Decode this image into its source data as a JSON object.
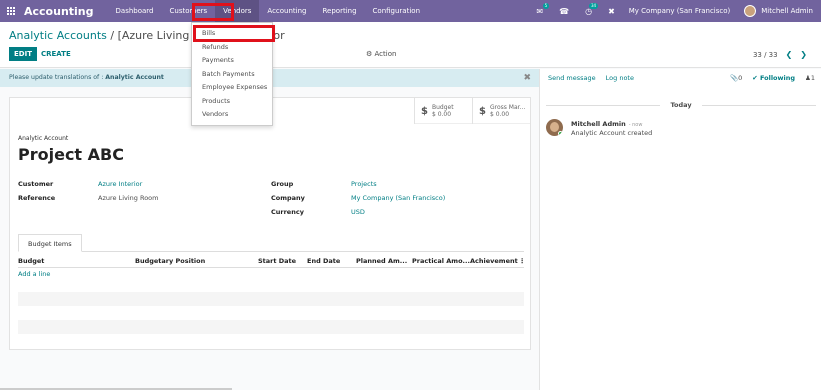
{
  "navbar": {
    "brand": "Accounting",
    "menu": [
      "Dashboard",
      "Customers",
      "Vendors",
      "Accounting",
      "Reporting",
      "Configuration"
    ],
    "chat_badge": "5",
    "activity_badge": "34",
    "company": "My Company (San Francisco)",
    "user": "Mitchell Admin"
  },
  "control": {
    "breadcrumb_parent": "Analytic Accounts",
    "breadcrumb_sep": " / ",
    "breadcrumb_current": "[Azure Living Room] Pr",
    "breadcrumb_tail": "erior",
    "edit": "EDIT",
    "create": "CREATE",
    "action": "Action",
    "pager": "33 / 33"
  },
  "alert": {
    "text": "Please update translations of :",
    "field": "Analytic Account"
  },
  "stats": [
    {
      "label": "Budget",
      "value": "$ 0.00"
    },
    {
      "label": "Gross Mar...",
      "value": "$ 0.00"
    }
  ],
  "form": {
    "label": "Analytic Account",
    "title": "Project ABC",
    "customer_label": "Customer",
    "customer_value": "Azure Interior",
    "reference_label": "Reference",
    "reference_value": "Azure Living Room",
    "group_label": "Group",
    "group_value": "Projects",
    "company_label": "Company",
    "company_value": "My Company (San Francisco)",
    "currency_label": "Currency",
    "currency_value": "USD"
  },
  "budget": {
    "tab": "Budget Items",
    "columns": [
      "Budget",
      "Budgetary Position",
      "Start Date",
      "End Date",
      "Planned Am...",
      "Practical Amo...",
      "Achievement"
    ],
    "add_line": "Add a line"
  },
  "dropdown": {
    "items": [
      "Bills",
      "Refunds",
      "Payments",
      "Batch Payments",
      "Employee Expenses",
      "Products",
      "Vendors"
    ]
  },
  "chatter": {
    "send_message": "Send message",
    "log_note": "Log note",
    "attachments": "0",
    "following": "Following",
    "followers": "1",
    "today": "Today",
    "author": "Mitchell Admin",
    "time": "- now",
    "body": "Analytic Account created"
  },
  "colors": {
    "navbar": "#71639e",
    "accent": "#017e84",
    "highlight": "#e0111b"
  }
}
